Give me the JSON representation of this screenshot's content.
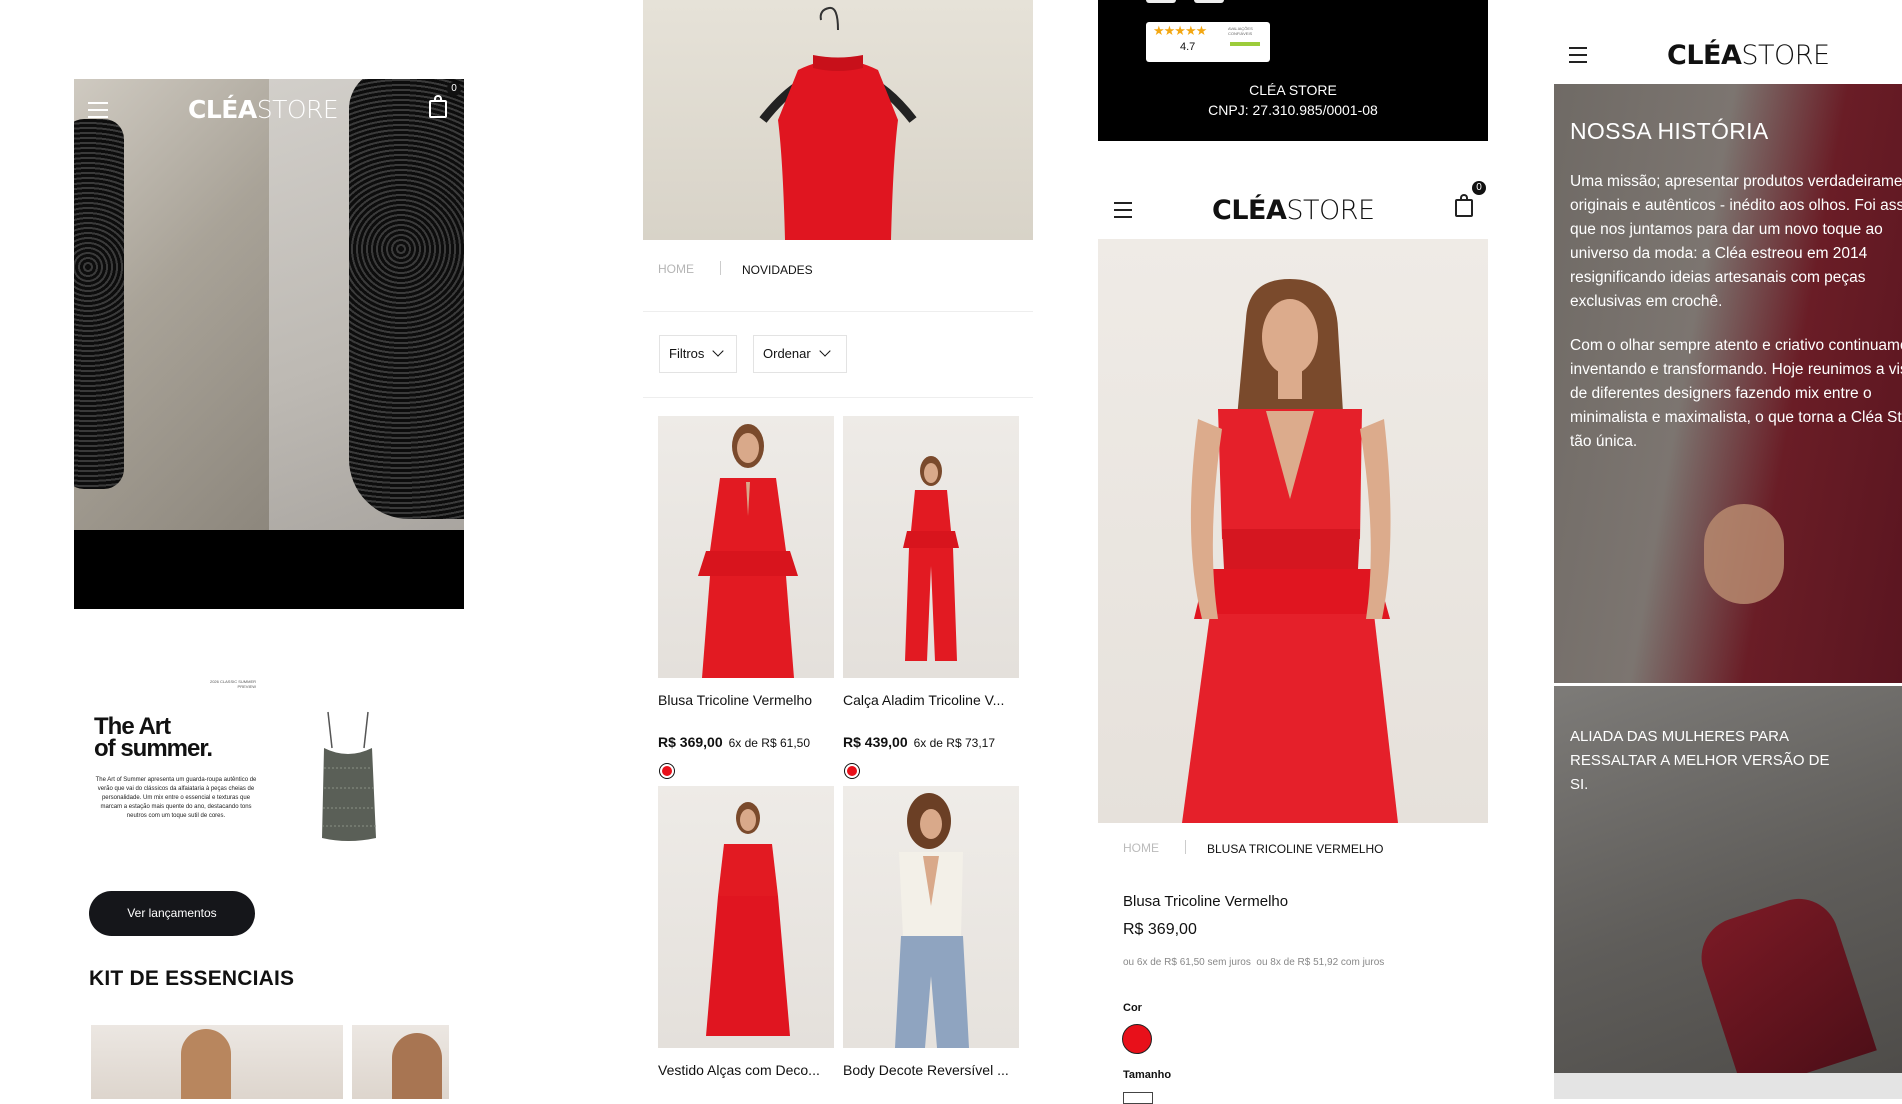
{
  "brand": {
    "logo_bold": "CLÉA",
    "logo_light": "STORE"
  },
  "screen1": {
    "cart_count": "0",
    "banner_kicker": "2026 CLASSIC SUMMER PREVIEW",
    "banner_title_1": "The Art",
    "banner_title_2": "of summer.",
    "banner_body": "The Art of Summer apresenta um guarda-roupa autêntico de verão que vai do clássicos da alfaiataria à peças cheias de personalidade. Um mix entre o essencial e texturas que marcam a estação mais quente do ano, destacando tons neutros com um toque sutil de cores.",
    "cta_label": "Ver lançamentos",
    "section_title": "KIT DE ESSENCIAIS"
  },
  "screen2": {
    "breadcrumb_home": "HOME",
    "breadcrumb_current": "NOVIDADES",
    "filter_label": "Filtros",
    "sort_label": "Ordenar",
    "products": [
      {
        "name": "Blusa Tricoline Vermelho",
        "price": "R$ 369,00",
        "installments": "6x de R$ 61,50",
        "color": "#e8101a"
      },
      {
        "name": "Calça Aladim Tricoline V...",
        "price": "R$ 439,00",
        "installments": "6x de R$ 73,17",
        "color": "#e8101a"
      },
      {
        "name": "Vestido Alças com Deco...",
        "price": "",
        "installments": "",
        "color": ""
      },
      {
        "name": "Body Decote Reversível ...",
        "price": "",
        "installments": "",
        "color": ""
      }
    ]
  },
  "screen3": {
    "rating_value": "4.7",
    "rating_caption": "AVALIAÇÕES CONFIÁVEIS",
    "company_name": "CLÉA STORE",
    "company_cnpj": "CNPJ: 27.310.985/0001-08",
    "cart_count": "0",
    "breadcrumb_home": "HOME",
    "breadcrumb_current": "BLUSA TRICOLINE VERMELHO",
    "product_name": "Blusa Tricoline Vermelho",
    "product_price": "R$ 369,00",
    "installments_text": "ou 6x de R$ 61,50 sem juros  ou 8x de R$ 51,92 com juros",
    "color_label": "Cor",
    "color_value": "#e8101a",
    "size_label": "Tamanho"
  },
  "screen4": {
    "history_title": "NOSSA HISTÓRIA",
    "history_p1": "Uma missão; apresentar produtos verdadeiramente originais e autênticos - inédito aos olhos. Foi assim que nos juntamos para dar um novo toque ao universo da moda: a Cléa estreou em 2014 resignificando ideias artesanais com peças exclusivas em crochê.",
    "history_p2": "Com o olhar sempre atento e criativo continuamos inventando e transformando. Hoje reunimos a visão de diferentes designers fazendo mix entre o minimalista e maximalista, o que torna a Cléa Store tão única.",
    "tagline": "ALIADA DAS MULHERES PARA RESSALTAR A MELHOR VERSÃO DE SI."
  },
  "colors": {
    "accent_red": "#e8101a",
    "black": "#000000",
    "burgundy": "#6e1a25"
  }
}
